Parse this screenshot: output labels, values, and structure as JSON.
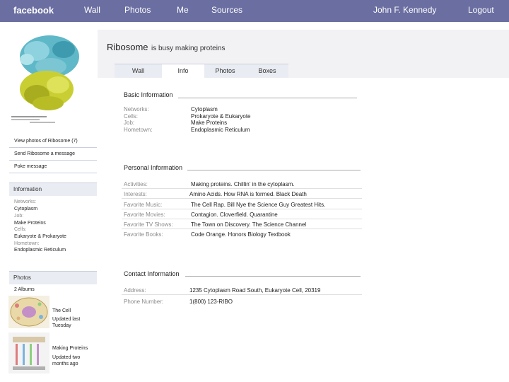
{
  "nav": {
    "logo": "facebook",
    "wall": "Wall",
    "photos": "Photos",
    "me": "Me",
    "sources": "Sources",
    "user": "John F. Kennedy",
    "logout": "Logout"
  },
  "profile": {
    "name": "Ribosome",
    "status": "is busy making proteins",
    "photo_icon": "ribosome-structure-image"
  },
  "tabs": [
    "Wall",
    "Info",
    "Photos",
    "Boxes"
  ],
  "active_tab": "Info",
  "sidebar": {
    "view_photos": "View photos of Ribosome (7)",
    "send_message": "Send Ribosome a message",
    "poke": "Poke message",
    "information_title": "Information",
    "info": [
      {
        "label": "Networks:",
        "value": "Cytoplasm"
      },
      {
        "label": "Job:",
        "value": "Make Proteins"
      },
      {
        "label": "Cells:",
        "value": "Eukaryote & Prokaryote"
      },
      {
        "label": "Hometown:",
        "value": "Endoplasmic Reticulum"
      }
    ],
    "photos_title": "Photos",
    "albums_count": "2 Albums",
    "albums": [
      {
        "title": "The Cell",
        "updated": "Updated last",
        "updated2": "Tuesday"
      },
      {
        "title": "Making Proteins",
        "updated": "Updated two",
        "updated2": "months ago"
      }
    ]
  },
  "basic": {
    "title": "Basic Information",
    "labels": [
      "Networks:",
      "Cells:",
      "Job:",
      "Hometown:"
    ],
    "values": [
      "Cytoplasm",
      "Prokaryote & Eukaryote",
      "Make Proteins",
      "Endoplasmic Reticulum"
    ]
  },
  "personal": {
    "title": "Personal Information",
    "rows": [
      {
        "label": "Activities:",
        "value": "Making proteins. Chillin' in the cytoplasm."
      },
      {
        "label": "Interests:",
        "value": "Amino Acids. How RNA is formed. Black Death"
      },
      {
        "label": "Favorite Music:",
        "value": "The Cell Rap. Bill Nye the Science Guy Greatest Hits."
      },
      {
        "label": "Favorite Movies:",
        "value": "Contagion. Cloverfield. Quarantine"
      },
      {
        "label": "Favorite TV Shows:",
        "value": "The Town on Discovery. The Science Channel"
      },
      {
        "label": "Favorite Books:",
        "value": "Code Orange. Honors Biology Textbook"
      }
    ]
  },
  "contact": {
    "title": "Contact Information",
    "rows": [
      {
        "label": "Address:",
        "value": "1235 Cytoplasm Road South, Eukaryote Cell, 20319"
      },
      {
        "label": "Phone Number:",
        "value": "1(800) 123-RIBO"
      }
    ]
  }
}
